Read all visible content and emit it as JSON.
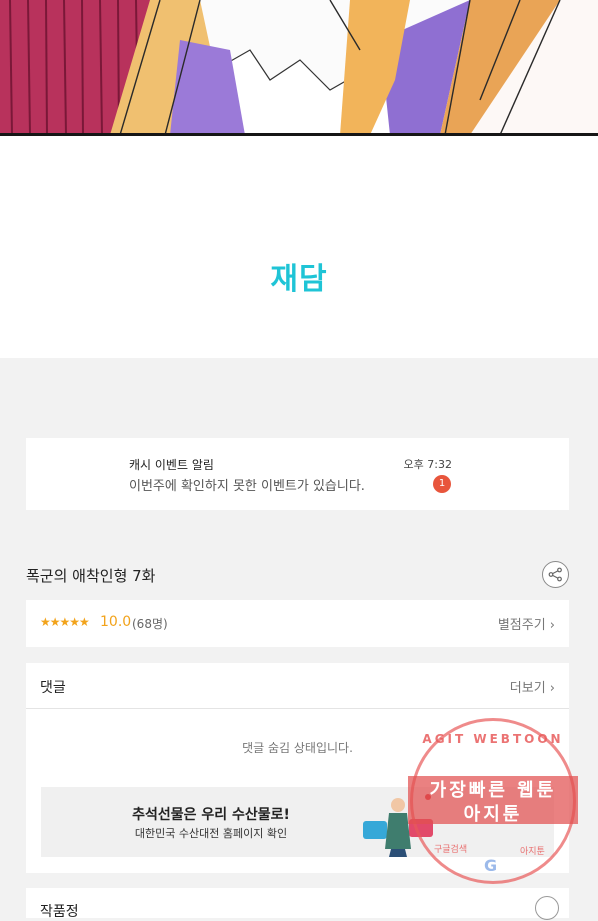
{
  "logo": {
    "text": "재담"
  },
  "notice": {
    "title": "캐시 이벤트 알림",
    "text": "이번주에 확인하지 못한 이벤트가 있습니다.",
    "time": "오후 7:32",
    "badge": "1"
  },
  "episode": {
    "title": "폭군의 애착인형 7화"
  },
  "rating": {
    "stars": "★★★★★",
    "score": "10.0",
    "count": "(68명)",
    "action": "별점주기 ›"
  },
  "comments": {
    "title": "댓글",
    "more": "더보기 ›",
    "hidden_message": "댓글 숨김 상태입니다."
  },
  "ad": {
    "title": "추석선물은 우리 수산물로!",
    "subtitle": "대한민국 수산대전 홈페이지 확인"
  },
  "next": {
    "title": "작품정"
  },
  "watermark": {
    "top": "AGIT WEBTOON",
    "line1": "가장빠른 웹툰",
    "line2": "아지툰",
    "bottom_left": "구글검색",
    "bottom_right": "아지툰",
    "google": "G"
  },
  "colors": {
    "logo": "#1fc4d6",
    "rating": "#f2a31b",
    "badge": "#e8553c",
    "watermark": "#e25050"
  }
}
